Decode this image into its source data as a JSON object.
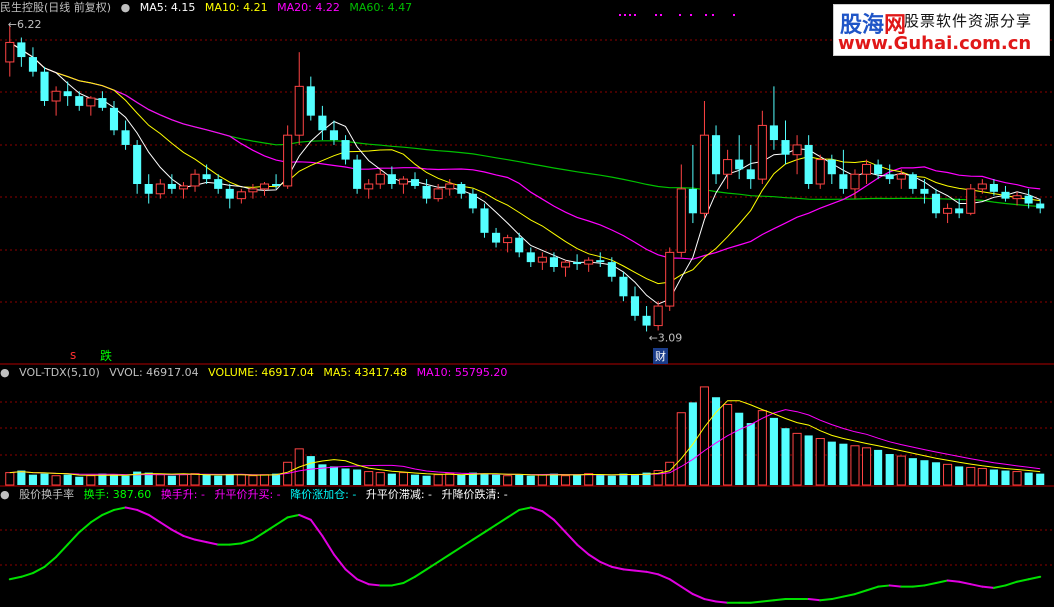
{
  "colors": {
    "up": "#ff4444",
    "down": "#54ffff",
    "ma5": "#ffffff",
    "ma10": "#ffff00",
    "ma20": "#ff00ff",
    "ma60": "#00c000",
    "grid": "#8b0000",
    "label": "#c0c0c0"
  },
  "panels": {
    "price": {
      "title": "民生控股(日线 前复权)",
      "ma5": "MA5: 4.15",
      "ma10": "MA10: 4.21",
      "ma20": "MA20: 4.22",
      "ma60": "MA60: 4.47",
      "high_label": "6.22",
      "low_label": "3.09",
      "marker_s": "s",
      "marker_die": "跌",
      "marker_cai": "财"
    },
    "volume": {
      "title": "VOL-TDX(5,10)",
      "vvol": "VVOL: 46917.04",
      "volume": "VOLUME: 46917.04",
      "ma5": "MA5: 43417.48",
      "ma10": "MA10: 55795.20"
    },
    "turnover": {
      "title": "股价换手率",
      "huanshou": "换手: 387.60",
      "huanshou_up": "换手升: -",
      "rise_buy": "升平价升买: -",
      "fall_add": "降价涨加仓: -",
      "rise_stall": "升平价滞减: -",
      "fall_clear": "升降价跌清: -"
    }
  },
  "logo": {
    "name_a": "股海",
    "name_b": "网",
    "slogan": "股票软件资源分享",
    "url": "www.Guhai.com.cn"
  },
  "chart_data": [
    {
      "type": "candlestick",
      "panel": "price",
      "ylim": [
        2.9,
        6.3
      ],
      "annotations": [
        "6.22",
        "3.09"
      ],
      "candles": [
        [
          5.85,
          6.22,
          5.7,
          6.05
        ],
        [
          6.05,
          6.1,
          5.8,
          5.9
        ],
        [
          5.9,
          6.0,
          5.7,
          5.75
        ],
        [
          5.75,
          5.8,
          5.4,
          5.45
        ],
        [
          5.45,
          5.6,
          5.3,
          5.55
        ],
        [
          5.55,
          5.65,
          5.4,
          5.5
        ],
        [
          5.5,
          5.55,
          5.35,
          5.4
        ],
        [
          5.4,
          5.5,
          5.3,
          5.48
        ],
        [
          5.48,
          5.55,
          5.35,
          5.38
        ],
        [
          5.38,
          5.45,
          5.1,
          5.15
        ],
        [
          5.15,
          5.25,
          4.95,
          5.0
        ],
        [
          5.0,
          5.05,
          4.5,
          4.6
        ],
        [
          4.6,
          4.7,
          4.4,
          4.5
        ],
        [
          4.5,
          4.65,
          4.45,
          4.6
        ],
        [
          4.6,
          4.7,
          4.5,
          4.55
        ],
        [
          4.55,
          4.62,
          4.45,
          4.58
        ],
        [
          4.58,
          4.75,
          4.52,
          4.7
        ],
        [
          4.7,
          4.8,
          4.6,
          4.65
        ],
        [
          4.65,
          4.7,
          4.5,
          4.55
        ],
        [
          4.55,
          4.6,
          4.35,
          4.45
        ],
        [
          4.45,
          4.55,
          4.4,
          4.52
        ],
        [
          4.52,
          4.6,
          4.45,
          4.55
        ],
        [
          4.55,
          4.62,
          4.48,
          4.6
        ],
        [
          4.6,
          4.7,
          4.55,
          4.58
        ],
        [
          4.58,
          5.2,
          4.55,
          5.1
        ],
        [
          5.1,
          5.95,
          5.0,
          5.6
        ],
        [
          5.6,
          5.7,
          5.25,
          5.3
        ],
        [
          5.3,
          5.4,
          5.05,
          5.15
        ],
        [
          5.15,
          5.25,
          5.0,
          5.05
        ],
        [
          5.05,
          5.1,
          4.8,
          4.85
        ],
        [
          4.85,
          4.9,
          4.5,
          4.55
        ],
        [
          4.55,
          4.65,
          4.45,
          4.6
        ],
        [
          4.6,
          4.75,
          4.55,
          4.7
        ],
        [
          4.7,
          4.78,
          4.55,
          4.6
        ],
        [
          4.6,
          4.68,
          4.5,
          4.65
        ],
        [
          4.65,
          4.72,
          4.55,
          4.58
        ],
        [
          4.58,
          4.65,
          4.4,
          4.45
        ],
        [
          4.45,
          4.6,
          4.42,
          4.55
        ],
        [
          4.55,
          4.65,
          4.48,
          4.6
        ],
        [
          4.6,
          4.62,
          4.45,
          4.5
        ],
        [
          4.5,
          4.55,
          4.3,
          4.35
        ],
        [
          4.35,
          4.4,
          4.05,
          4.1
        ],
        [
          4.1,
          4.15,
          3.95,
          4.0
        ],
        [
          4.0,
          4.08,
          3.9,
          4.05
        ],
        [
          4.05,
          4.1,
          3.85,
          3.9
        ],
        [
          3.9,
          3.95,
          3.75,
          3.8
        ],
        [
          3.8,
          3.9,
          3.72,
          3.85
        ],
        [
          3.85,
          3.9,
          3.7,
          3.75
        ],
        [
          3.75,
          3.82,
          3.65,
          3.8
        ],
        [
          3.8,
          3.88,
          3.72,
          3.78
        ],
        [
          3.78,
          3.85,
          3.7,
          3.82
        ],
        [
          3.82,
          3.9,
          3.75,
          3.8
        ],
        [
          3.8,
          3.85,
          3.6,
          3.65
        ],
        [
          3.65,
          3.7,
          3.4,
          3.45
        ],
        [
          3.45,
          3.55,
          3.2,
          3.25
        ],
        [
          3.25,
          3.35,
          3.09,
          3.15
        ],
        [
          3.15,
          3.4,
          3.1,
          3.35
        ],
        [
          3.35,
          3.95,
          3.3,
          3.9
        ],
        [
          3.9,
          4.8,
          3.85,
          4.55
        ],
        [
          4.55,
          5.0,
          4.2,
          4.3
        ],
        [
          4.3,
          5.45,
          4.25,
          5.1
        ],
        [
          5.1,
          5.2,
          4.6,
          4.7
        ],
        [
          4.7,
          4.95,
          4.55,
          4.85
        ],
        [
          4.85,
          5.1,
          4.65,
          4.75
        ],
        [
          4.75,
          5.0,
          4.55,
          4.65
        ],
        [
          4.65,
          5.35,
          4.6,
          5.2
        ],
        [
          5.2,
          5.6,
          4.95,
          5.05
        ],
        [
          5.05,
          5.25,
          4.8,
          4.9
        ],
        [
          4.9,
          5.1,
          4.7,
          5.0
        ],
        [
          5.0,
          5.1,
          4.55,
          4.6
        ],
        [
          4.6,
          4.9,
          4.55,
          4.85
        ],
        [
          4.85,
          4.9,
          4.6,
          4.7
        ],
        [
          4.7,
          4.95,
          4.5,
          4.55
        ],
        [
          4.55,
          4.75,
          4.45,
          4.7
        ],
        [
          4.7,
          4.85,
          4.6,
          4.8
        ],
        [
          4.8,
          4.85,
          4.65,
          4.7
        ],
        [
          4.7,
          4.8,
          4.6,
          4.65
        ],
        [
          4.65,
          4.75,
          4.55,
          4.7
        ],
        [
          4.7,
          4.72,
          4.5,
          4.55
        ],
        [
          4.55,
          4.65,
          4.4,
          4.5
        ],
        [
          4.5,
          4.55,
          4.25,
          4.3
        ],
        [
          4.3,
          4.4,
          4.2,
          4.35
        ],
        [
          4.35,
          4.45,
          4.25,
          4.3
        ],
        [
          4.3,
          4.6,
          4.28,
          4.55
        ],
        [
          4.55,
          4.65,
          4.5,
          4.6
        ],
        [
          4.6,
          4.65,
          4.48,
          4.52
        ],
        [
          4.52,
          4.58,
          4.42,
          4.45
        ],
        [
          4.45,
          4.52,
          4.38,
          4.48
        ],
        [
          4.48,
          4.55,
          4.35,
          4.4
        ],
        [
          4.4,
          4.45,
          4.3,
          4.35
        ]
      ]
    },
    {
      "type": "bar",
      "panel": "volume",
      "series": [
        {
          "name": "VOLUME",
          "values": [
            12,
            14,
            10,
            11,
            9,
            10,
            8,
            9,
            11,
            10,
            9,
            13,
            12,
            10,
            9,
            10,
            11,
            10,
            9,
            10,
            10,
            9,
            10,
            11,
            22,
            35,
            28,
            20,
            18,
            16,
            15,
            13,
            12,
            11,
            12,
            10,
            9,
            10,
            11,
            10,
            12,
            11,
            10,
            9,
            10,
            9,
            10,
            11,
            9,
            10,
            11,
            10,
            9,
            11,
            10,
            12,
            14,
            22,
            70,
            80,
            95,
            85,
            78,
            70,
            60,
            72,
            65,
            55,
            50,
            48,
            45,
            42,
            40,
            38,
            36,
            34,
            30,
            28,
            26,
            24,
            22,
            20,
            18,
            17,
            16,
            15,
            14,
            13,
            12,
            11
          ]
        }
      ],
      "up_flags_source": "price"
    },
    {
      "type": "line",
      "panel": "turnover",
      "series": [
        {
          "name": "换手",
          "values": [
            20,
            22,
            25,
            30,
            38,
            48,
            58,
            66,
            72,
            76,
            78,
            76,
            72,
            66,
            60,
            55,
            52,
            50,
            48,
            48,
            49,
            52,
            58,
            64,
            70,
            72,
            68,
            55,
            40,
            28,
            20,
            16,
            15,
            15,
            17,
            22,
            28,
            34,
            40,
            46,
            52,
            58,
            64,
            70,
            76,
            78,
            75,
            68,
            58,
            48,
            40,
            34,
            30,
            28,
            27,
            26,
            24,
            20,
            14,
            8,
            4,
            2,
            1,
            1,
            1,
            2,
            3,
            4,
            4,
            4,
            3,
            4,
            6,
            8,
            11,
            14,
            15,
            14,
            14,
            15,
            17,
            19,
            18,
            16,
            14,
            13,
            15,
            18,
            20,
            22
          ]
        }
      ]
    }
  ]
}
